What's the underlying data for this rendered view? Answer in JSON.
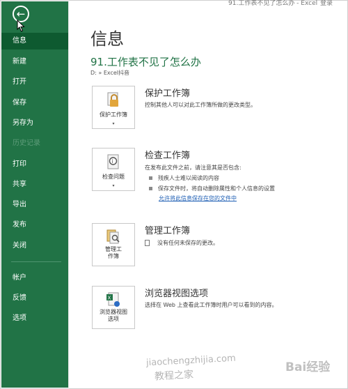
{
  "top": {
    "title_fragment": "91.工作表不见了怎么办 - Excel",
    "right_fragment": "登录"
  },
  "sidebar": {
    "back_icon": "back-arrow-icon",
    "items": [
      {
        "label": "信息"
      },
      {
        "label": "新建"
      },
      {
        "label": "打开"
      },
      {
        "label": "保存"
      },
      {
        "label": "另存为"
      },
      {
        "label": "历史记录"
      },
      {
        "label": "打印"
      },
      {
        "label": "共享"
      },
      {
        "label": "导出"
      },
      {
        "label": "发布"
      },
      {
        "label": "关闭"
      },
      {
        "label": "帐户"
      },
      {
        "label": "反馈"
      },
      {
        "label": "选项"
      }
    ],
    "active_index": 0,
    "disabled_index": 5,
    "colors": {
      "background": "#217346",
      "active": "#0e5a30"
    }
  },
  "main": {
    "title": "信息",
    "doc_title": "91.工作表不见了怎么办",
    "doc_path": "D: » Excel抖音",
    "sections": [
      {
        "tile_label": "保护工作簿",
        "icon": "lock-icon",
        "title": "保护工作簿",
        "desc": "控制其他人可以对此工作簿所做的更改类型。"
      },
      {
        "tile_label": "检查问题",
        "icon": "inspect-icon",
        "title": "检查工作簿",
        "desc": "在发布此文件之前，请注意其是否包含:",
        "bullets": [
          "残疾人士难以阅读的内容",
          "保存文件时，将自动删除属性和个人信息的设置"
        ],
        "link": "允许将此信息保存在您的文件中"
      },
      {
        "tile_label_line1": "管理工",
        "tile_label_line2": "作簿",
        "icon": "manage-icon",
        "title": "管理工作簿",
        "desc": "没有任何未保存的更改。"
      },
      {
        "tile_label_line1": "浏览器视图",
        "tile_label_line2": "选项",
        "icon": "browser-view-icon",
        "title": "浏览器视图选项",
        "desc": "选择在 Web 上查看此工作簿时用户可以看到的内容。"
      }
    ]
  },
  "watermarks": {
    "site_pinyin": "jiaochengzhijia.com",
    "site_cn": "教程之家",
    "brand": "Bai经验"
  },
  "accent": "#217346"
}
